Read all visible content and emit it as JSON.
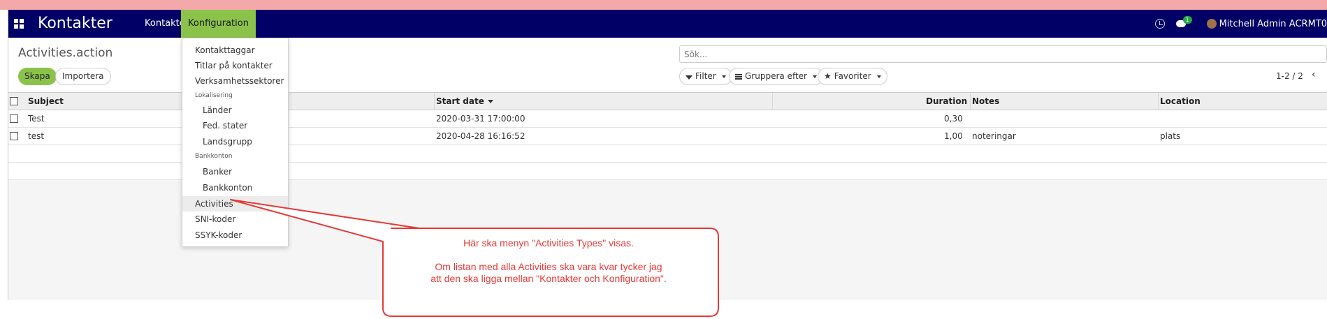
{
  "navbar": {
    "brand": "Kontakter",
    "menu": [
      "Kontakter",
      "Konfiguration"
    ],
    "chat_badge": "1",
    "user": "Mitchell Admin ACRMT0"
  },
  "control_panel": {
    "title": "Activities.action",
    "create_label": "Skapa",
    "import_label": "Importera",
    "search_placeholder": "Sök...",
    "filter_label": "Filter",
    "groupby_label": "Gruppera efter",
    "favorites_label": "Favoriter",
    "pager": "1-2 / 2"
  },
  "table": {
    "columns": [
      "Subject",
      "Start date",
      "Duration",
      "Notes",
      "Location"
    ],
    "rows": [
      {
        "subject": "Test",
        "start_date": "2020-03-31 17:00:00",
        "duration": "0,30",
        "notes": "",
        "location": ""
      },
      {
        "subject": "test",
        "start_date": "2020-04-28 16:16:52",
        "duration": "1,00",
        "notes": "noteringar",
        "location": "plats"
      }
    ]
  },
  "dropdown": {
    "items": [
      "Kontakttaggar",
      "Titlar på kontakter",
      "Verksamhetssektorer",
      "Lokalisering",
      "Länder",
      "Fed. stater",
      "Landsgrupp",
      "Bankkonton",
      "Banker",
      "Bankkonton",
      "Activities",
      "SNI-koder",
      "SSYK-koder"
    ]
  },
  "annotation": {
    "line1": "Här ska menyn \"Activities Types\" visas.",
    "line2": "Om listan med alla Activities ska vara kvar tycker jag",
    "line3": "att den ska ligga mellan \"Kontakter och Konfiguration\"."
  },
  "colors": {
    "navbar": "#000066",
    "active_menu": "#8bc34a",
    "annotation": "#e53935"
  }
}
